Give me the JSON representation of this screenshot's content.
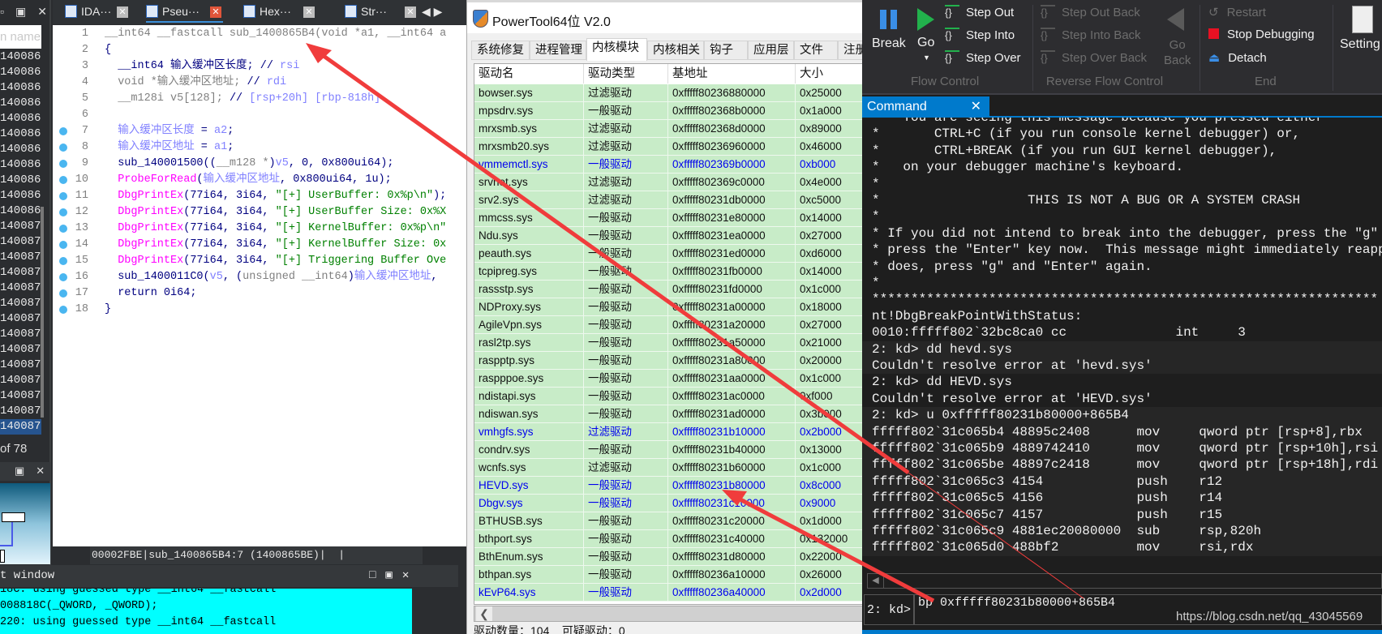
{
  "ida": {
    "tabs": [
      {
        "label": "IDA···",
        "icon": "ida-view-icon"
      },
      {
        "label": "Pseu···",
        "icon": "pseudocode-icon"
      },
      {
        "label": "Hex···",
        "icon": "hex-view-icon"
      },
      {
        "label": "Str···",
        "icon": "strings-icon"
      }
    ],
    "function_list_placeholder": "n name",
    "function_rows": [
      "140086",
      "140086",
      "140086",
      "140086",
      "140086",
      "140086",
      "140086",
      "140086",
      "140086",
      "140086",
      "140086",
      "140087",
      "140087",
      "140087",
      "140087",
      "140087",
      "140087",
      "140087",
      "140087",
      "140087",
      "140087",
      "140087",
      "140087",
      "140087",
      "140087"
    ],
    "function_count": "of 78",
    "code_lines": [
      {
        "n": "1",
        "bp": false,
        "t": [
          {
            "c": "g",
            "s": "__int64 __fastcall sub_1400865B4(void *a1, __int64 a"
          }
        ]
      },
      {
        "n": "2",
        "bp": false,
        "t": [
          {
            "c": "n",
            "s": "{"
          }
        ]
      },
      {
        "n": "3",
        "bp": false,
        "t": [
          {
            "c": "n",
            "s": "  __int64 输入缓冲区长度; // "
          },
          {
            "c": "v",
            "s": "rsi"
          }
        ]
      },
      {
        "n": "4",
        "bp": false,
        "t": [
          {
            "c": "g",
            "s": "  void *输入缓冲区地址; "
          },
          {
            "c": "n",
            "s": "// "
          },
          {
            "c": "v",
            "s": "rdi"
          }
        ]
      },
      {
        "n": "5",
        "bp": false,
        "t": [
          {
            "c": "g",
            "s": "  __m128i v5[128]; "
          },
          {
            "c": "n",
            "s": "// "
          },
          {
            "c": "v",
            "s": "[rsp+20h] [rbp-818h]"
          }
        ]
      },
      {
        "n": "6",
        "bp": false,
        "t": []
      },
      {
        "n": "7",
        "bp": true,
        "t": [
          {
            "c": "v",
            "s": "  输入缓冲区长度"
          },
          {
            "c": "n",
            "s": " = "
          },
          {
            "c": "v",
            "s": "a2"
          },
          {
            "c": "n",
            "s": ";"
          }
        ]
      },
      {
        "n": "8",
        "bp": true,
        "t": [
          {
            "c": "v",
            "s": "  输入缓冲区地址"
          },
          {
            "c": "n",
            "s": " = "
          },
          {
            "c": "v",
            "s": "a1"
          },
          {
            "c": "n",
            "s": ";"
          }
        ]
      },
      {
        "n": "9",
        "bp": true,
        "t": [
          {
            "c": "n",
            "s": "  sub_140001500(("
          },
          {
            "c": "g",
            "s": "__m128 *"
          },
          {
            "c": "n",
            "s": ")"
          },
          {
            "c": "v",
            "s": "v5"
          },
          {
            "c": "n",
            "s": ", 0, 0x800ui64);"
          }
        ]
      },
      {
        "n": "10",
        "bp": true,
        "t": [
          {
            "c": "m",
            "s": "  ProbeForRead"
          },
          {
            "c": "n",
            "s": "("
          },
          {
            "c": "v",
            "s": "输入缓冲区地址"
          },
          {
            "c": "n",
            "s": ", 0x800ui64, 1u);"
          }
        ]
      },
      {
        "n": "11",
        "bp": true,
        "t": [
          {
            "c": "m",
            "s": "  DbgPrintEx"
          },
          {
            "c": "n",
            "s": "(77i64, 3i64, "
          },
          {
            "c": "s",
            "s": "\"[+] UserBuffer: 0x%p\\n\""
          },
          {
            "c": "n",
            "s": ");"
          }
        ]
      },
      {
        "n": "12",
        "bp": true,
        "t": [
          {
            "c": "m",
            "s": "  DbgPrintEx"
          },
          {
            "c": "n",
            "s": "(77i64, 3i64, "
          },
          {
            "c": "s",
            "s": "\"[+] UserBuffer Size: 0x%X"
          }
        ]
      },
      {
        "n": "13",
        "bp": true,
        "t": [
          {
            "c": "m",
            "s": "  DbgPrintEx"
          },
          {
            "c": "n",
            "s": "(77i64, 3i64, "
          },
          {
            "c": "s",
            "s": "\"[+] KernelBuffer: 0x%p\\n\""
          }
        ]
      },
      {
        "n": "14",
        "bp": true,
        "t": [
          {
            "c": "m",
            "s": "  DbgPrintEx"
          },
          {
            "c": "n",
            "s": "(77i64, 3i64, "
          },
          {
            "c": "s",
            "s": "\"[+] KernelBuffer Size: 0x"
          }
        ]
      },
      {
        "n": "15",
        "bp": true,
        "t": [
          {
            "c": "m",
            "s": "  DbgPrintEx"
          },
          {
            "c": "n",
            "s": "(77i64, 3i64, "
          },
          {
            "c": "s",
            "s": "\"[+] Triggering Buffer Ove"
          }
        ]
      },
      {
        "n": "16",
        "bp": true,
        "t": [
          {
            "c": "n",
            "s": "  sub_1400011C0("
          },
          {
            "c": "v",
            "s": "v5"
          },
          {
            "c": "n",
            "s": ", ("
          },
          {
            "c": "g",
            "s": "unsigned __int64"
          },
          {
            "c": "n",
            "s": ")"
          },
          {
            "c": "v",
            "s": "输入缓冲区地址"
          },
          {
            "c": "n",
            "s": ","
          }
        ]
      },
      {
        "n": "17",
        "bp": true,
        "t": [
          {
            "c": "n",
            "s": "  return 0i64;"
          }
        ]
      },
      {
        "n": "18",
        "bp": true,
        "t": [
          {
            "c": "n",
            "s": "}"
          }
        ]
      }
    ],
    "status_bar": "00002FBE|sub_1400865B4:7 (1400865BE)|  |",
    "output_window_title": "t window",
    "output_lines": [
      "18C: using guessed type __int64 __fastcall",
      "008818C(_QWORD, _QWORD);",
      "220: using guessed type __int64 __fastcall"
    ]
  },
  "powertool": {
    "title": "PowerTool64位 V2.0",
    "tabs": [
      "系统修复",
      "进程管理",
      "内核模块",
      "内核相关",
      "钩子",
      "应用层",
      "文件",
      "注册"
    ],
    "active_tab": "内核模块",
    "columns": [
      "驱动名",
      "驱动类型",
      "基地址",
      "大小"
    ],
    "rows": [
      [
        "bowser.sys",
        "过滤驱动",
        "0xfffff80236880000",
        "0x25000",
        false
      ],
      [
        "mpsdrv.sys",
        "一般驱动",
        "0xfffff802368b0000",
        "0x1a000",
        false
      ],
      [
        "mrxsmb.sys",
        "过滤驱动",
        "0xfffff802368d0000",
        "0x89000",
        false
      ],
      [
        "mrxsmb20.sys",
        "过滤驱动",
        "0xfffff80236960000",
        "0x46000",
        false
      ],
      [
        "vmmemctl.sys",
        "一般驱动",
        "0xfffff802369b0000",
        "0xb000",
        true
      ],
      [
        "srvnet.sys",
        "过滤驱动",
        "0xfffff802369c0000",
        "0x4e000",
        false
      ],
      [
        "srv2.sys",
        "过滤驱动",
        "0xfffff80231db0000",
        "0xc5000",
        false
      ],
      [
        "mmcss.sys",
        "一般驱动",
        "0xfffff80231e80000",
        "0x14000",
        false
      ],
      [
        "Ndu.sys",
        "一般驱动",
        "0xfffff80231ea0000",
        "0x27000",
        false
      ],
      [
        "peauth.sys",
        "一般驱动",
        "0xfffff80231ed0000",
        "0xd6000",
        false
      ],
      [
        "tcpipreg.sys",
        "一般驱动",
        "0xfffff80231fb0000",
        "0x14000",
        false
      ],
      [
        "rassstp.sys",
        "一般驱动",
        "0xfffff80231fd0000",
        "0x1c000",
        false
      ],
      [
        "NDProxy.sys",
        "一般驱动",
        "0xfffff80231a00000",
        "0x18000",
        false
      ],
      [
        "AgileVpn.sys",
        "一般驱动",
        "0xfffff80231a20000",
        "0x27000",
        false
      ],
      [
        "rasl2tp.sys",
        "一般驱动",
        "0xfffff80231a50000",
        "0x21000",
        false
      ],
      [
        "raspptp.sys",
        "一般驱动",
        "0xfffff80231a80000",
        "0x20000",
        false
      ],
      [
        "raspppoe.sys",
        "一般驱动",
        "0xfffff80231aa0000",
        "0x1c000",
        false
      ],
      [
        "ndistapi.sys",
        "一般驱动",
        "0xfffff80231ac0000",
        "0xf000",
        false
      ],
      [
        "ndiswan.sys",
        "一般驱动",
        "0xfffff80231ad0000",
        "0x3b000",
        false
      ],
      [
        "vmhgfs.sys",
        "过滤驱动",
        "0xfffff80231b10000",
        "0x2b000",
        true
      ],
      [
        "condrv.sys",
        "一般驱动",
        "0xfffff80231b40000",
        "0x13000",
        false
      ],
      [
        "wcnfs.sys",
        "过滤驱动",
        "0xfffff80231b60000",
        "0x1c000",
        false
      ],
      [
        "HEVD.sys",
        "一般驱动",
        "0xfffff80231b80000",
        "0x8c000",
        true
      ],
      [
        "Dbgv.sys",
        "一般驱动",
        "0xfffff80231c10000",
        "0x9000",
        true
      ],
      [
        "BTHUSB.sys",
        "一般驱动",
        "0xfffff80231c20000",
        "0x1d000",
        false
      ],
      [
        "bthport.sys",
        "一般驱动",
        "0xfffff80231c40000",
        "0x132000",
        false
      ],
      [
        "BthEnum.sys",
        "一般驱动",
        "0xfffff80231d80000",
        "0x22000",
        false
      ],
      [
        "bthpan.sys",
        "一般驱动",
        "0xfffff80236a10000",
        "0x26000",
        false
      ],
      [
        "kEvP64.sys",
        "一般驱动",
        "0xfffff80236a40000",
        "0x2d000",
        true
      ]
    ],
    "status": "驱动数量：104    可疑驱动：0",
    "colors": {
      "row_bg": "#c8ecc8",
      "highlight_text": "#0000ee"
    }
  },
  "debugger": {
    "ribbon": {
      "break": "Break",
      "go": "Go",
      "step_out": "Step Out",
      "step_into": "Step Into",
      "step_over": "Step Over",
      "step_out_back": "Step Out Back",
      "step_into_back": "Step Into Back",
      "step_over_back": "Step Over Back",
      "go_back_1": "Go",
      "go_back_2": "Back",
      "restart": "Restart",
      "stop": "Stop Debugging",
      "detach": "Detach",
      "settings": "Setting",
      "group_flow": "Flow Control",
      "group_reverse": "Reverse Flow Control",
      "group_end": "End"
    },
    "command_tab": "Command",
    "lines": [
      "*   You are seeing this message because you pressed either",
      "*       CTRL+C (if you run console kernel debugger) or,",
      "*       CTRL+BREAK (if you run GUI kernel debugger),",
      "*   on your debugger machine's keyboard.",
      "*",
      "*                   THIS IS NOT A BUG OR A SYSTEM CRASH",
      "*",
      "* If you did not intend to break into the debugger, press the \"g\"",
      "* press the \"Enter\" key now.  This message might immediately reapp",
      "* does, press \"g\" and \"Enter\" again.",
      "*",
      "*****************************************************************",
      "nt!DbgBreakPointWithStatus:",
      "0010:fffff802`32bc8ca0 cc              int     3",
      "2: kd> dd hevd.sys",
      "Couldn't resolve error at 'hevd.sys'",
      "2: kd> dd HEVD.sys",
      "Couldn't resolve error at 'HEVD.sys'",
      "2: kd> u 0xfffff80231b80000+865B4",
      "fffff802`31c065b4 48895c2408      mov     qword ptr [rsp+8],rbx",
      "fffff802`31c065b9 4889742410      mov     qword ptr [rsp+10h],rsi",
      "fffff802`31c065be 48897c2418      mov     qword ptr [rsp+18h],rdi",
      "fffff802`31c065c3 4154            push    r12",
      "fffff802`31c065c5 4156            push    r14",
      "fffff802`31c065c7 4157            push    r15",
      "fffff802`31c065c9 4881ec20080000  sub     rsp,820h",
      "fffff802`31c065d0 488bf2          mov     rsi,rdx"
    ],
    "prompt": "2: kd>",
    "input_value": "bp 0xfffff80231b80000+865B4",
    "watermark": "https://blog.csdn.net/qq_43045569",
    "colors": {
      "accent": "#007acc",
      "annotation_arrow": "#f03c3c"
    }
  }
}
